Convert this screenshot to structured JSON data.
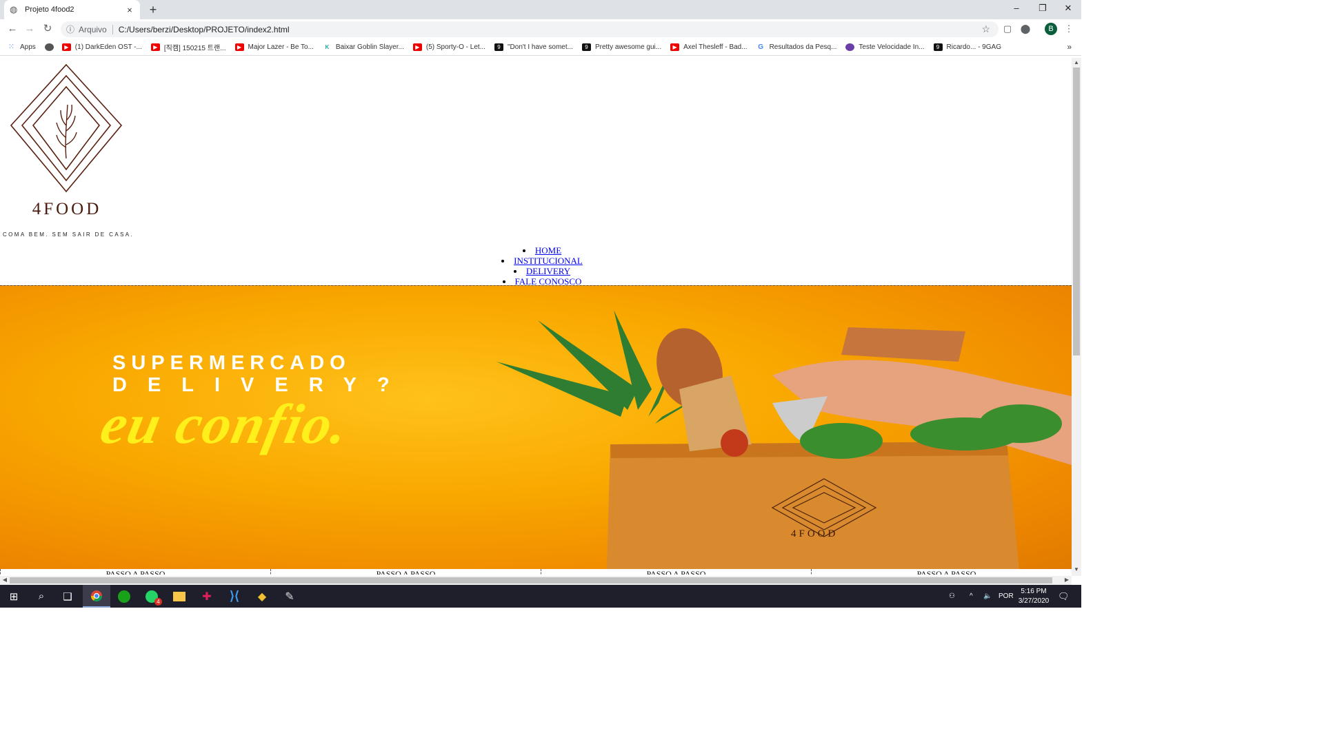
{
  "browser": {
    "tab_title": "Projeto 4food2",
    "tab_close": "×",
    "new_tab": "+",
    "security_label": "Arquivo",
    "url": "C:/Users/berzi/Desktop/PROJETO/index2.html",
    "profile_initial": "B",
    "window_controls": [
      "–",
      "❐",
      "✕"
    ]
  },
  "bookmarks": [
    {
      "label": "Apps",
      "icon": "apps-icon"
    },
    {
      "label": "",
      "icon": "web-icon"
    },
    {
      "label": "(1) DarkEden OST -...",
      "icon": "youtube-icon"
    },
    {
      "label": "[직캠] 150215 트랜...",
      "icon": "youtube-icon"
    },
    {
      "label": "Major Lazer - Be To...",
      "icon": "youtube-icon"
    },
    {
      "label": "Baixar Goblin Slayer...",
      "icon": "km-icon"
    },
    {
      "label": "(5) Sporty-O - Let...",
      "icon": "youtube-icon"
    },
    {
      "label": "\"Don't I have somet...",
      "icon": "9gag-icon"
    },
    {
      "label": "Pretty awesome gui...",
      "icon": "9gag-icon"
    },
    {
      "label": "Axel Thesleff - Bad...",
      "icon": "youtube-icon"
    },
    {
      "label": "Resultados da Pesq...",
      "icon": "google-icon"
    },
    {
      "label": "Teste Velocidade In...",
      "icon": "speedtest-icon"
    },
    {
      "label": "Ricardo... - 9GAG",
      "icon": "9gag-icon"
    }
  ],
  "bookmarks_more": "»",
  "page": {
    "brand": "4FOOD",
    "tagline": "COMA BEM. SEM SAIR DE CASA.",
    "menu": [
      "HOME",
      "INSTITUCIONAL",
      "DELIVERY",
      "FALE CONOSCO"
    ],
    "hero": {
      "line1": "SUPERMERCADO",
      "line2": "DELIVERY?",
      "script": "eu confio.",
      "bag_brand": "4FOOD"
    },
    "steps": [
      "PASSO A PASSO",
      "PASSO A PASSO",
      "PASSO A PASSO",
      "PASSO A PASSO"
    ]
  },
  "taskbar": {
    "language": "POR",
    "time": "5:16 PM",
    "date": "3/27/2020",
    "whatsapp_badge": "4"
  },
  "colors": {
    "brand_brown": "#4a1a0c",
    "hero_orange": "#f9a800",
    "script_yellow": "#ffef1a",
    "link_blue": "#0000ee"
  }
}
